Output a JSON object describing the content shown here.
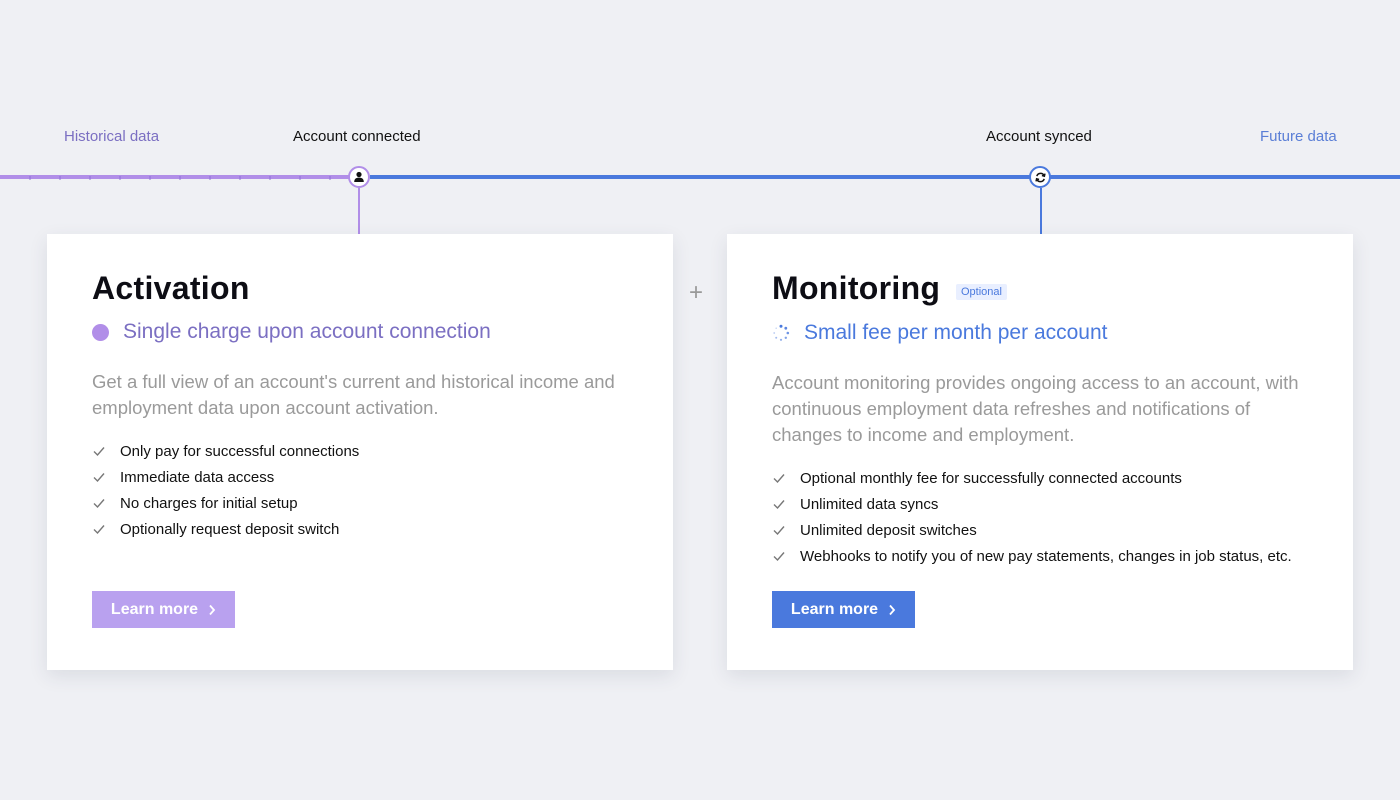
{
  "timeline": {
    "historical_label": "Historical data",
    "connected_label": "Account connected",
    "synced_label": "Account synced",
    "future_label": "Future data"
  },
  "colors": {
    "purple": "#b18ee8",
    "purple_text": "#7b6fc2",
    "blue": "#4a79dd",
    "background": "#eff0f4"
  },
  "activation": {
    "title": "Activation",
    "subtitle": "Single charge upon account connection",
    "description": "Get a full view of an account's current and historical income and employment data upon account activation.",
    "features": [
      "Only pay for successful connections",
      "Immediate data access",
      "No charges for initial setup",
      "Optionally request deposit switch"
    ],
    "button_label": "Learn more"
  },
  "separator": "+",
  "monitoring": {
    "title": "Monitoring",
    "badge": "Optional",
    "subtitle": "Small fee per month per account",
    "description": "Account monitoring provides ongoing access to an account, with continuous employment data refreshes and notifications of changes to income and employment.",
    "features": [
      "Optional monthly fee for successfully connected accounts",
      "Unlimited data syncs",
      "Unlimited deposit switches",
      "Webhooks to notify you of new pay statements, changes in job status, etc."
    ],
    "button_label": "Learn more"
  },
  "icons": {
    "connected_node": "user-icon",
    "synced_node": "sync-icon",
    "feature_check": "check-icon",
    "button_arrow": "chevron-right-icon",
    "activation_marker": "dot-icon",
    "monitoring_marker": "spinner-icon"
  }
}
